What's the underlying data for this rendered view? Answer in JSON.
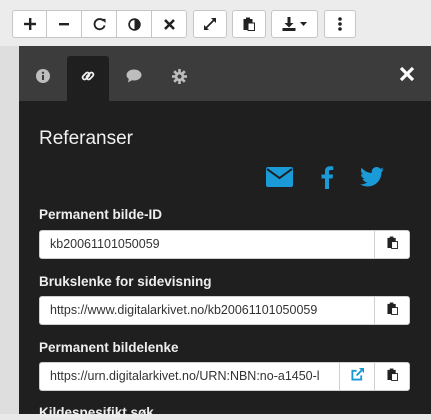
{
  "toolbar": {
    "buttons": [
      {
        "icon": "plus-icon"
      },
      {
        "icon": "minus-icon"
      },
      {
        "icon": "refresh-icon"
      },
      {
        "icon": "contrast-icon"
      },
      {
        "icon": "close-icon"
      },
      {
        "icon": "fullscreen-icon"
      },
      {
        "icon": "clipboard-icon"
      },
      {
        "icon": "download-icon"
      },
      {
        "icon": "more-vertical-icon"
      }
    ]
  },
  "tabs": [
    {
      "icon": "info-icon",
      "active": false
    },
    {
      "icon": "link-icon",
      "active": true
    },
    {
      "icon": "comment-icon",
      "active": false
    },
    {
      "icon": "settings-gear-icon",
      "active": false
    }
  ],
  "panel": {
    "title": "Referanser",
    "social": [
      "email-icon",
      "facebook-icon",
      "twitter-icon"
    ],
    "fields": [
      {
        "label": "Permanent bilde-ID",
        "value": "kb20061101050059"
      },
      {
        "label": "Brukslenke for sidevisning",
        "value": "https://www.digitalarkivet.no/kb20061101050059"
      },
      {
        "label": "Permanent bildelenke",
        "value": "https://urn.digitalarkivet.no/URN:NBN:no-a1450-l"
      },
      {
        "label": "Kildespesifikt søk",
        "value": ""
      }
    ]
  },
  "colors": {
    "panel_bg": "#1f1f1f",
    "tab_bar_bg": "#3c3c3c",
    "accent_blue": "#1a9ad6",
    "toolbar_bg": "#ececec"
  }
}
